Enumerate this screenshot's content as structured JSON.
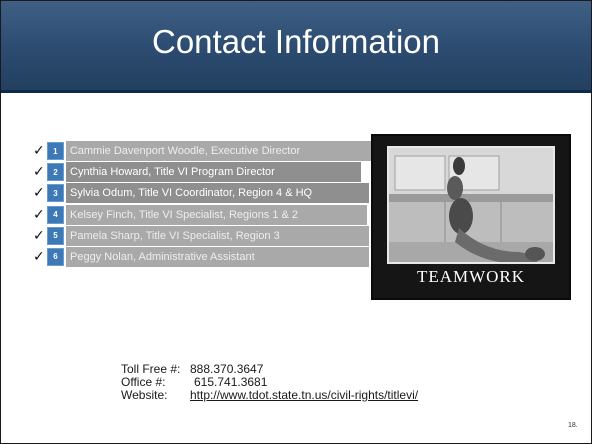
{
  "title": "Contact Information",
  "contacts": [
    {
      "num": "1",
      "label": "Cammie Davenport Woodle, Executive Director"
    },
    {
      "num": "2",
      "label": "Cynthia Howard, Title VI Program Director"
    },
    {
      "num": "3",
      "label": "Sylvia Odum, Title VI Coordinator, Region 4 & HQ"
    },
    {
      "num": "4",
      "label": "Kelsey Finch, Title VI Specialist, Regions 1 & 2"
    },
    {
      "num": "5",
      "label": "Pamela Sharp, Title VI Specialist, Region 3"
    },
    {
      "num": "6",
      "label": " Peggy Nolan, Administrative Assistant"
    }
  ],
  "check_glyph": "✓",
  "poster": {
    "caption": "TEAMWORK"
  },
  "phone": {
    "toll_free_label": "Toll Free #:",
    "toll_free": "888.370.3647",
    "office_label": "Office #:",
    "office": "615.741.3681",
    "website_label": "Website:",
    "website": "http://www.tdot.state.tn.us/civil-rights/titlevi/"
  },
  "page_number": "18."
}
